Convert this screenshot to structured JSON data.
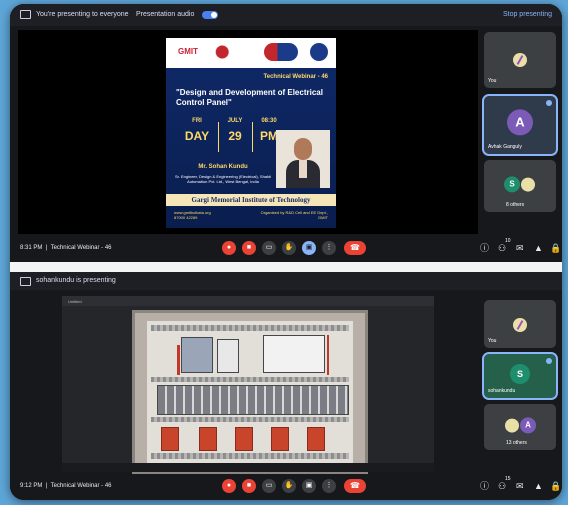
{
  "meet1": {
    "banner": {
      "presenting": "You're presenting to everyone",
      "audio": "Presentation audio",
      "stop": "Stop presenting"
    },
    "poster": {
      "logo_text": "GMIT",
      "series": "Technical Webinar - 46",
      "title": "\"Design and Development of Electrical Control Panel\"",
      "day_small": "FRI",
      "day_big": "DAY",
      "month_small": "JULY",
      "date_big": "29",
      "time_small": "08:30",
      "ampm_big": "PM",
      "speaker_name": "Mr. Sohan Kundu",
      "speaker_role": "Sr. Engineer, Design & Engineering (Electrical), Shakti Automation Pvt. Ltd., West Bengal, India",
      "institute": "Gargi Memorial Institute of Technology",
      "website": "www.gmitkolkata.org",
      "phone": "87000 42289",
      "organiser": "Organised by R&D Cell and EE Dept., GMIT"
    },
    "time": "8:31 PM",
    "meeting": "Technical Webinar - 46",
    "tiles": [
      {
        "name": "You"
      },
      {
        "name": "Avhak Ganguly",
        "initial": "A"
      },
      {
        "name": "8 others",
        "initial": "S"
      }
    ],
    "people_badge": "10"
  },
  "meet2": {
    "banner": {
      "presenting": "sohankundu is presenting"
    },
    "viewer_title": "Untitled",
    "time": "9:12 PM",
    "meeting": "Technical Webinar - 46",
    "tiles": [
      {
        "name": "You"
      },
      {
        "name": "sohankundu",
        "initial": "S"
      },
      {
        "name": "13 others",
        "initial": "A"
      }
    ],
    "people_badge": "15"
  }
}
